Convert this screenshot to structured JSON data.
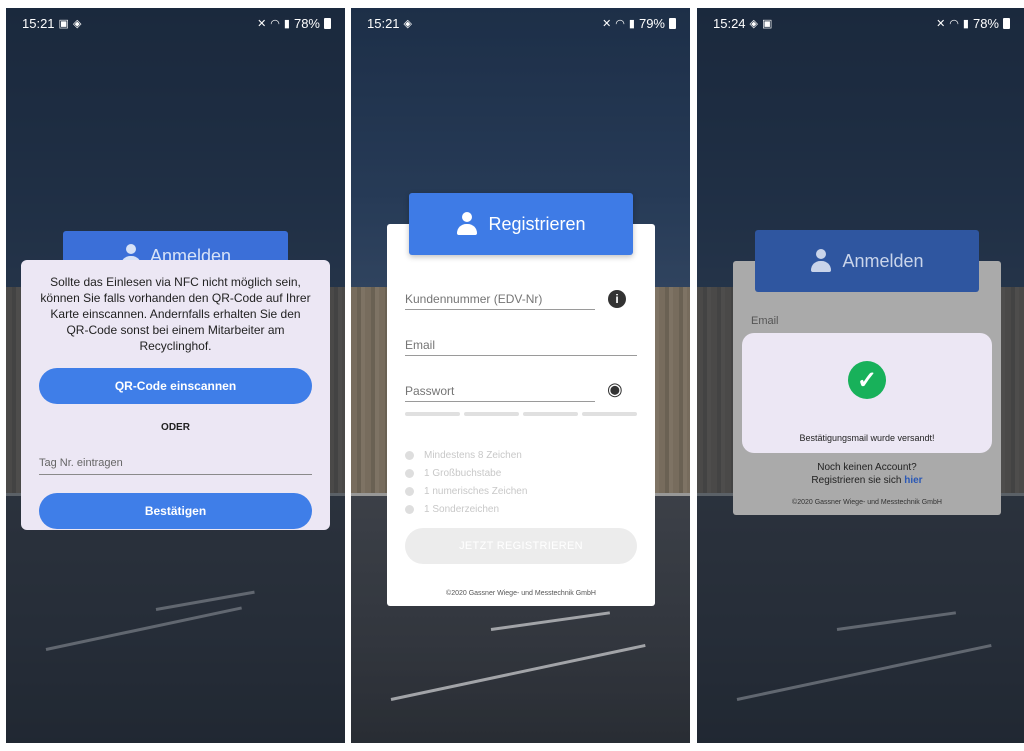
{
  "phones": [
    {
      "status": {
        "time": "15:21",
        "battery": "78%"
      },
      "behind_button": "Anmelden",
      "dialog": {
        "message": "Sollte das Einlesen via NFC nicht möglich sein, können Sie falls vorhanden den QR-Code auf Ihrer Karte einscannen. Andernfalls erhalten Sie den QR-Code sonst bei einem Mitarbeiter am Recyclinghof.",
        "qr_button": "QR-Code einscannen",
        "or_label": "ODER",
        "tag_placeholder": "Tag Nr. eintragen",
        "confirm_button": "Bestätigen"
      }
    },
    {
      "status": {
        "time": "15:21",
        "battery": "79%"
      },
      "header": "Registrieren",
      "fields": {
        "customer_number": "Kundennummer (EDV-Nr)",
        "email": "Email",
        "password": "Passwort"
      },
      "rules": [
        "Mindestens 8 Zeichen",
        "1 Großbuchstabe",
        "1 numerisches Zeichen",
        "1 Sonderzeichen"
      ],
      "register_button": "JETZT REGISTRIEREN",
      "copyright": "©2020 Gassner Wiege- und Messtechnik GmbH"
    },
    {
      "status": {
        "time": "15:24",
        "battery": "78%"
      },
      "header": "Anmelden",
      "email_label": "Email",
      "dialog": {
        "message": "Bestätigungsmail wurde versandt!"
      },
      "no_account": "Noch keinen Account?",
      "register_prefix": "Registrieren sie sich ",
      "register_link": "hier",
      "copyright": "©2020 Gassner Wiege- und Messtechnik GmbH"
    }
  ],
  "colors": {
    "primary": "#3f7ee8",
    "success": "#18b15a",
    "dialog": "#ece7f4"
  },
  "icons": [
    "image-icon",
    "android-icon",
    "mute-icon",
    "wifi-icon",
    "signal-icon",
    "battery-icon",
    "person-icon",
    "info-icon",
    "eye-icon",
    "check-icon"
  ]
}
